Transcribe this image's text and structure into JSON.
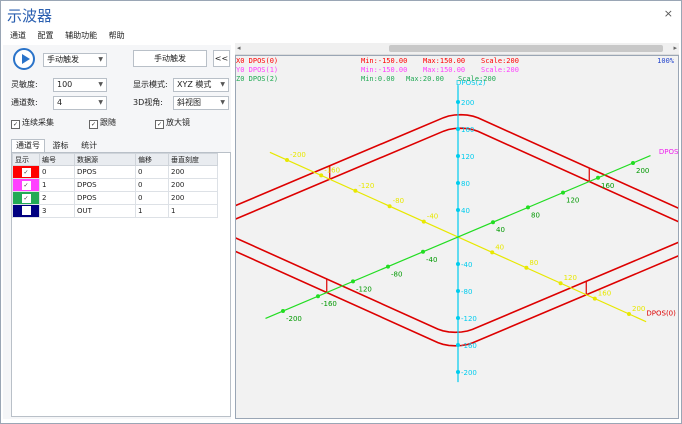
{
  "window": {
    "title": "示波器",
    "close_glyph": "×"
  },
  "menu": [
    "通道",
    "配置",
    "辅助功能",
    "帮助"
  ],
  "scrollbar": {
    "left_arrow": "◂",
    "right_arrow": "▸"
  },
  "controls": {
    "trigger_mode": "手动触发",
    "manual_trigger_button": "手动触发",
    "collapse_button": "<<",
    "sensitivity_label": "灵敏度:",
    "sensitivity_value": "100",
    "display_mode_label": "显示模式:",
    "display_mode_value": "XYZ 模式",
    "channels_label": "通道数:",
    "channels_value": "4",
    "view3d_label": "3D视角:",
    "view3d_value": "斜视图",
    "continuous": "连续采集",
    "follow": "跟随",
    "magnifier": "放大镜"
  },
  "tabs": [
    "通道号",
    "游标",
    "统计"
  ],
  "table": {
    "headers": [
      "显示",
      "编号",
      "数据源",
      "偏移",
      "垂直刻度"
    ],
    "rows": [
      {
        "color": "#ff0000",
        "id": "0",
        "source": "DPOS",
        "offset": "0",
        "scale": "200",
        "checked": true
      },
      {
        "color": "#ff40ff",
        "id": "1",
        "source": "DPOS",
        "offset": "0",
        "scale": "200",
        "checked": true
      },
      {
        "color": "#22aa55",
        "id": "2",
        "source": "DPOS",
        "offset": "0",
        "scale": "200",
        "checked": true
      },
      {
        "color": "#000080",
        "id": "3",
        "source": "OUT",
        "offset": "1",
        "scale": "1",
        "checked": false
      }
    ]
  },
  "plot": {
    "zoom": "100%",
    "headers": [
      {
        "name": "X0 DPOS(0)",
        "min": "Min:-150.00",
        "max": "Max:150.00",
        "scale": "Scale:200",
        "color": "#ff0000"
      },
      {
        "name": "Y0 DPOS(1)",
        "min": "Min:-150.00",
        "max": "Max:150.00",
        "scale": "Scale:200",
        "color": "#ff40ff"
      },
      {
        "name": "Z0 DPOS(2)",
        "min": "Min:0.00",
        "max": "Max:20.00",
        "scale": "Scale:200",
        "color": "#22aa55"
      }
    ],
    "axis_names": {
      "x": "DPOS(0)",
      "y": "DPOS(1)",
      "z": "DPOS(2)"
    },
    "z_ticks": [
      "200",
      "160",
      "120",
      "80",
      "40",
      "0",
      "-40",
      "-80",
      "-120",
      "-160",
      "-200"
    ],
    "x_ticks": [
      "-200",
      "-160",
      "-120",
      "-80",
      "-40",
      "0",
      "40",
      "80",
      "120",
      "160",
      "200"
    ],
    "y_ticks": [
      "-200",
      "-160",
      "-120",
      "-80",
      "-40",
      "0",
      "40",
      "80",
      "120",
      "160",
      "200"
    ],
    "colors": {
      "x_axis": "#e8e800",
      "y_axis": "#22dd22",
      "z_axis": "#00ccee",
      "path": "#dd0000"
    }
  }
}
